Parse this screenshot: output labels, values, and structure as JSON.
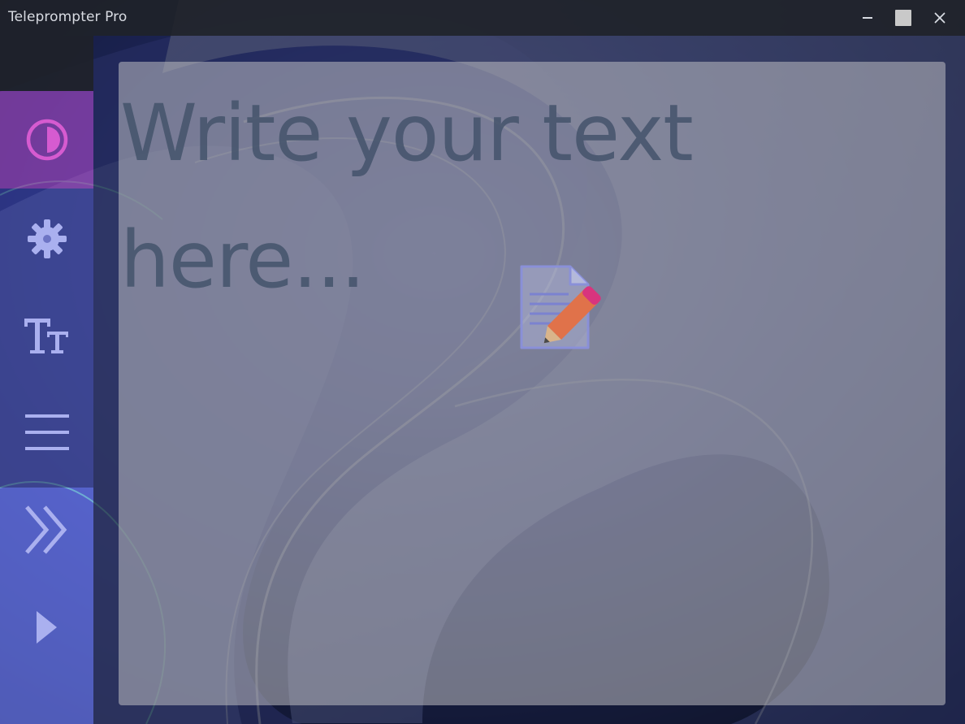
{
  "window": {
    "title": "Teleprompter Pro",
    "controls": [
      "minimize-icon",
      "maximize-icon",
      "close-icon"
    ]
  },
  "sidebar": {
    "items": [
      {
        "name": "theme",
        "icon": "contrast-icon",
        "active": true
      },
      {
        "name": "settings",
        "icon": "gear-icon",
        "active": false
      },
      {
        "name": "font",
        "icon": "text-size-icon",
        "active": false
      },
      {
        "name": "alignment",
        "icon": "menu-lines-icon",
        "active": false
      },
      {
        "name": "speed",
        "icon": "double-chevron-right-icon",
        "active": false
      },
      {
        "name": "play",
        "icon": "play-icon",
        "active": false
      }
    ],
    "accent": "#c34cbf"
  },
  "editor": {
    "placeholder": "Write your text here...",
    "placeholder_icon": "memo-pencil-icon"
  }
}
